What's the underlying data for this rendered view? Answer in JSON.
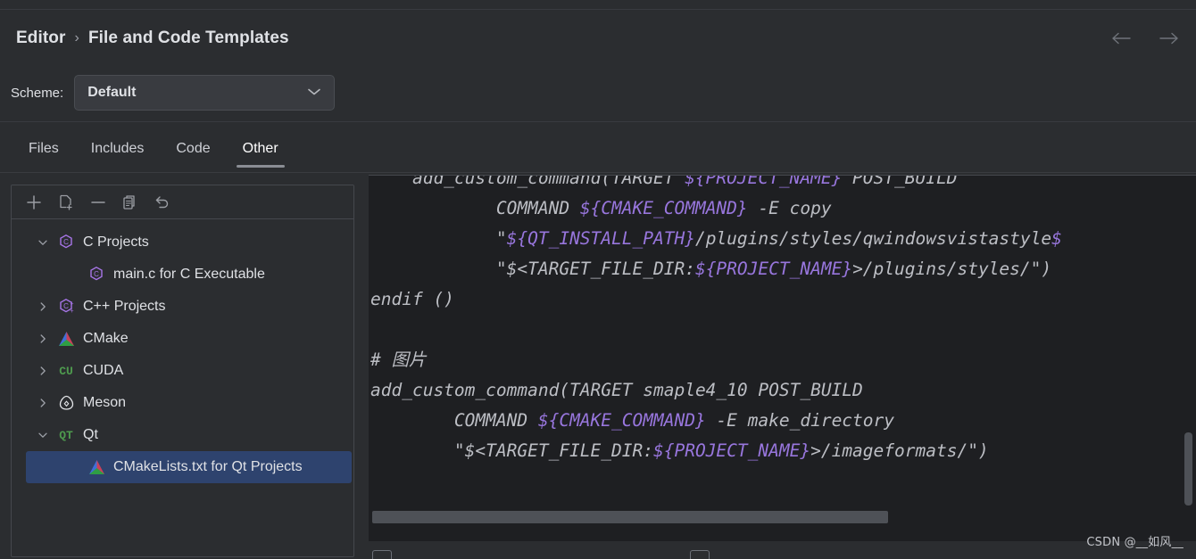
{
  "window": {
    "background_color": "#2b2d30",
    "editor_background_color": "#1e1f22",
    "accent_selection_color": "#2e436e",
    "variable_color": "#9876dd"
  },
  "breadcrumb": {
    "root": "Editor",
    "separator": "›",
    "current": "File and Code Templates"
  },
  "nav": {
    "back_icon": "arrow-left-icon",
    "forward_icon": "arrow-right-icon"
  },
  "scheme": {
    "label": "Scheme:",
    "value": "Default",
    "options": [
      "Default"
    ],
    "chevron_icon": "chevron-down-icon"
  },
  "tabs": [
    {
      "label": "Files",
      "active": false
    },
    {
      "label": "Includes",
      "active": false
    },
    {
      "label": "Code",
      "active": false
    },
    {
      "label": "Other",
      "active": true
    }
  ],
  "tree_toolbar": [
    {
      "name": "add-template-button",
      "icon": "plus-icon"
    },
    {
      "name": "copy-template-button",
      "icon": "new-file-icon"
    },
    {
      "name": "remove-template-button",
      "icon": "minus-icon"
    },
    {
      "name": "duplicate-button",
      "icon": "copy-icon"
    },
    {
      "name": "reset-to-default-button",
      "icon": "undo-icon"
    }
  ],
  "tree": [
    {
      "label": "C Projects",
      "icon": "c-hexagon-icon",
      "expanded": true,
      "indent": 0,
      "selected": false,
      "has_twisty": true
    },
    {
      "label": "main.c for C Executable",
      "icon": "c-hexagon-icon",
      "expanded": null,
      "indent": 1,
      "selected": false,
      "has_twisty": false
    },
    {
      "label": "C++ Projects",
      "icon": "cpp-hexagon-icon",
      "expanded": false,
      "indent": 0,
      "selected": false,
      "has_twisty": true
    },
    {
      "label": "CMake",
      "icon": "cmake-icon",
      "expanded": false,
      "indent": 0,
      "selected": false,
      "has_twisty": true
    },
    {
      "label": "CUDA",
      "icon": "cuda-text-icon",
      "expanded": false,
      "indent": 0,
      "selected": false,
      "has_twisty": true,
      "text_icon": "CU"
    },
    {
      "label": "Meson",
      "icon": "meson-icon",
      "expanded": false,
      "indent": 0,
      "selected": false,
      "has_twisty": true
    },
    {
      "label": "Qt",
      "icon": "qt-text-icon",
      "expanded": true,
      "indent": 0,
      "selected": false,
      "has_twisty": true,
      "text_icon": "QT"
    },
    {
      "label": "CMakeLists.txt for Qt Projects",
      "icon": "cmake-icon",
      "expanded": null,
      "indent": 1,
      "selected": true,
      "has_twisty": false
    }
  ],
  "code": {
    "lines": [
      [
        {
          "t": "    add_custom_command(TARGET "
        },
        {
          "t": "${PROJECT_NAME}",
          "c": "var"
        },
        {
          "t": " POST_BUILD"
        }
      ],
      [
        {
          "t": "            COMMAND "
        },
        {
          "t": "${CMAKE_COMMAND}",
          "c": "var"
        },
        {
          "t": " -E copy"
        }
      ],
      [
        {
          "t": "            \"",
          "c": ""
        },
        {
          "t": "${QT_INSTALL_PATH}",
          "c": "var"
        },
        {
          "t": "/plugins/styles/qwindowsvistastyle"
        },
        {
          "t": "$",
          "c": "var"
        }
      ],
      [
        {
          "t": "            \"$<TARGET_FILE_DIR:"
        },
        {
          "t": "${PROJECT_NAME}",
          "c": "var"
        },
        {
          "t": ">/plugins/styles/\")"
        }
      ],
      [
        {
          "t": "endif ()"
        }
      ],
      [
        {
          "t": ""
        }
      ],
      [
        {
          "t": "# "
        },
        {
          "t": "图片",
          "c": "cjk"
        }
      ],
      [
        {
          "t": "add_custom_command(TARGET smaple4_10 POST_BUILD"
        }
      ],
      [
        {
          "t": "        COMMAND "
        },
        {
          "t": "${CMAKE_COMMAND}",
          "c": "var"
        },
        {
          "t": " -E make_directory"
        }
      ],
      [
        {
          "t": "        \"$<TARGET_FILE_DIR:"
        },
        {
          "t": "${PROJECT_NAME}",
          "c": "var"
        },
        {
          "t": ">/imageformats/\")"
        }
      ]
    ]
  },
  "scrollbars": {
    "horizontal_name": "editor-horizontal-scrollbar",
    "vertical_name": "editor-vertical-scrollbar"
  },
  "watermark": "CSDN @__如风__"
}
